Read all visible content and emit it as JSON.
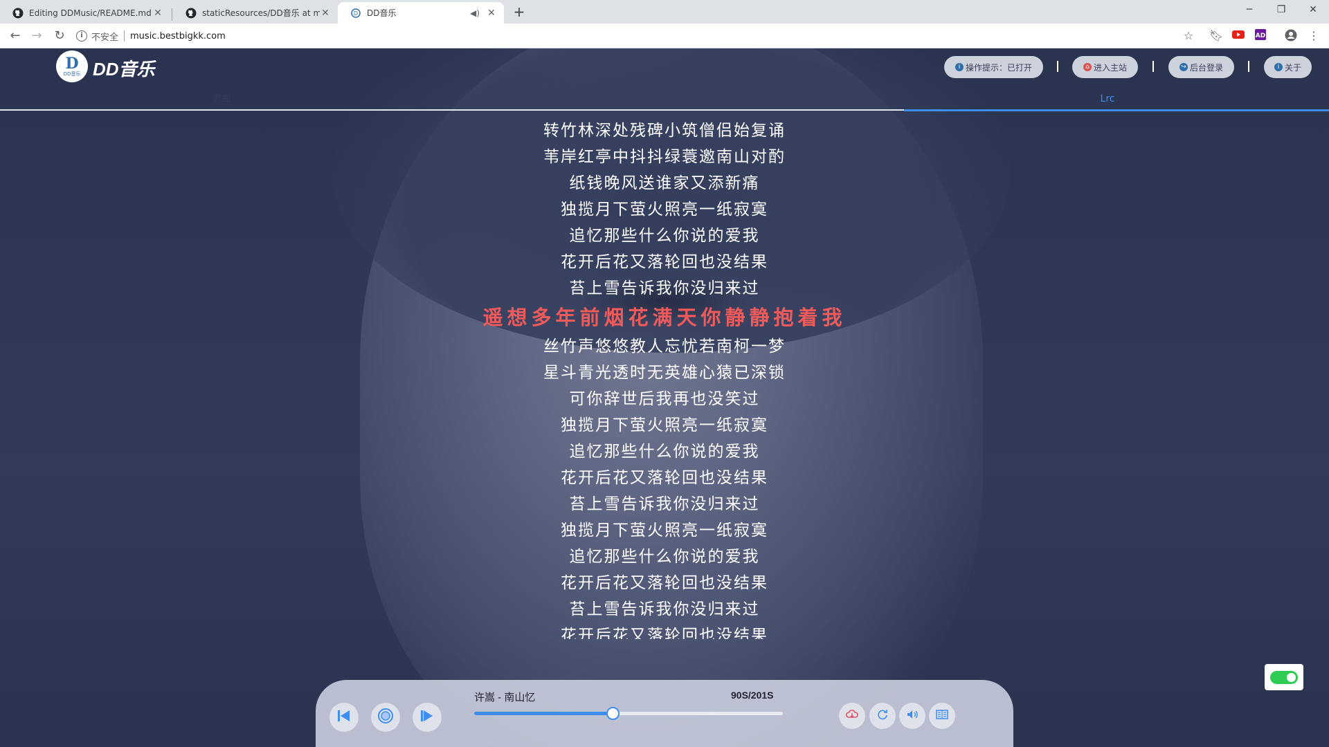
{
  "browser": {
    "tabs": [
      {
        "label": "Editing DDMusic/README.md at",
        "icon": "github-icon"
      },
      {
        "label": "staticResources/DD音乐 at maste",
        "icon": "github-icon"
      },
      {
        "label": "DD音乐",
        "icon": "dd-favicon-icon",
        "active": true,
        "audio_icon": "speaker-icon"
      }
    ],
    "address": {
      "security_label": "不安全",
      "url": "music.bestbigkk.com"
    }
  },
  "header": {
    "logo_text": "D",
    "logo_subtext": "DD音乐",
    "brand": "DD音乐",
    "buttons": [
      {
        "label": "操作提示：已打开",
        "icon": "info-icon",
        "color": "#2f6ea8"
      },
      {
        "label": "进入主站",
        "icon": "home-icon",
        "color": "#d9534f"
      },
      {
        "label": "后台登录",
        "icon": "login-icon",
        "color": "#2f6ea8"
      },
      {
        "label": "关于",
        "icon": "info-icon",
        "color": "#2f6ea8"
      }
    ]
  },
  "nav_tabs": [
    {
      "label": "歌曲",
      "active": false
    },
    {
      "label": "播放列表",
      "active": false
    },
    {
      "label": "Lrc",
      "active": true
    }
  ],
  "lyrics": {
    "lines": [
      "转竹林深处残碑小筑僧侣始复诵",
      "苇岸红亭中抖抖绿蓑邀南山对酌",
      "纸钱晚风送谁家又添新痛",
      "独揽月下萤火照亮一纸寂寞",
      "追忆那些什么你说的爱我",
      "花开后花又落轮回也没结果",
      "苔上雪告诉我你没归来过",
      "遥想多年前烟花满天你静静抱着我",
      "丝竹声悠悠教人忘忧若南柯一梦",
      "星斗青光透时无英雄心猿已深锁",
      "可你辞世后我再也没笑过",
      "独揽月下萤火照亮一纸寂寞",
      "追忆那些什么你说的爱我",
      "花开后花又落轮回也没结果",
      "苔上雪告诉我你没归来过",
      "独揽月下萤火照亮一纸寂寞",
      "追忆那些什么你说的爱我",
      "花开后花又落轮回也没结果",
      "苔上雪告诉我你没归来过",
      "花开后花又落轮回也没结果"
    ],
    "current_index": 7,
    "highlight_color": "#ef5a5a"
  },
  "player": {
    "song": "许嵩 - 南山忆",
    "time": "90S/201S",
    "position_s": 90,
    "duration_s": 201,
    "accent": "#3d8ef0",
    "buttons": {
      "prev": "previous-icon",
      "playpause": "pause-icon",
      "next": "next-icon",
      "download": "download-icon",
      "loop": "loop-icon",
      "volume": "volume-icon",
      "lyrics": "lyrics-icon"
    }
  },
  "toggle": {
    "on": true,
    "color": "#2ecc52"
  }
}
